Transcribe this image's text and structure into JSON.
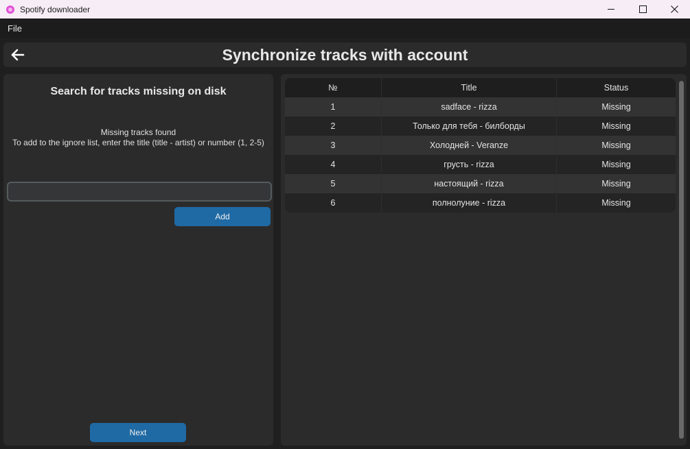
{
  "window": {
    "title": "Spotify downloader"
  },
  "menu": {
    "file": "File"
  },
  "header": {
    "title": "Synchronize tracks with account",
    "back_icon": "arrow-left-icon"
  },
  "left": {
    "heading": "Search for tracks missing on disk",
    "info_line1": "Missing tracks found",
    "info_line2": "To add to the ignore list, enter the title (title - artist) or number (1, 2-5)",
    "input_value": "",
    "add_label": "Add",
    "next_label": "Next"
  },
  "table": {
    "headers": [
      "№",
      "Title",
      "Status"
    ],
    "rows": [
      {
        "num": "1",
        "title": "sadface - rizza",
        "status": "Missing"
      },
      {
        "num": "2",
        "title": "Только для тебя - билборды",
        "status": "Missing"
      },
      {
        "num": "3",
        "title": "Холодней - Veranze",
        "status": "Missing"
      },
      {
        "num": "4",
        "title": "грусть - rizza",
        "status": "Missing"
      },
      {
        "num": "5",
        "title": "настоящий - rizza",
        "status": "Missing"
      },
      {
        "num": "6",
        "title": "полнолуние - rizza",
        "status": "Missing"
      }
    ]
  },
  "colors": {
    "accent": "#1f6aa5",
    "background": "#1f1f1f",
    "panel": "#2b2b2b"
  }
}
